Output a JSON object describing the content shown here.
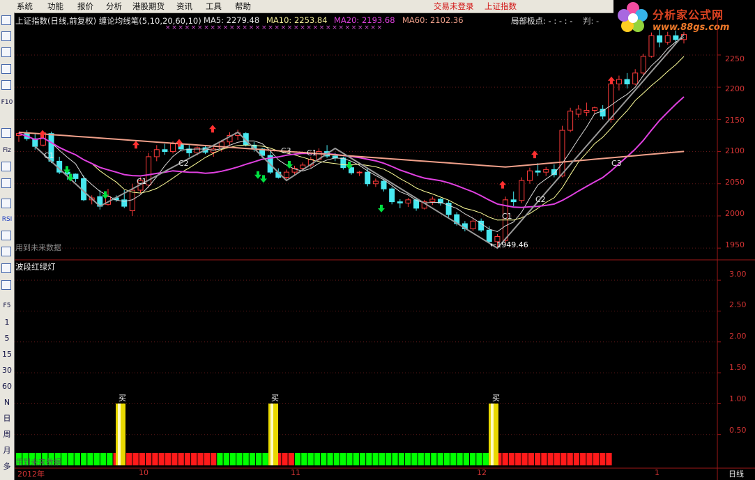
{
  "menu": {
    "items": [
      "系统",
      "功能",
      "报价",
      "分析",
      "港股期货",
      "资讯",
      "工具",
      "帮助"
    ],
    "login_status": "交易未登录",
    "index_name": "上证指数"
  },
  "logo": {
    "title": "分析家公式网",
    "url": "www.88gs.com"
  },
  "toolbar": {
    "labels": [
      "F10",
      "Fiz",
      "RSI",
      "F5",
      "1",
      "5",
      "15",
      "30",
      "60",
      "N",
      "日",
      "周",
      "月",
      "多"
    ]
  },
  "header": {
    "title": "上证指数(日线,前复权) 缠论均线笔(5,10,20,60,10)",
    "ma5": "MA5: 2279.48",
    "ma10": "MA10: 2253.84",
    "ma20": "MA20: 2193.68",
    "ma60": "MA60: 2102.36",
    "local_extreme": "局部极点: - : - : -",
    "judge": "判: -"
  },
  "main_panel": {
    "y_ticks": [
      "2250",
      "2200",
      "2150",
      "2100",
      "2050",
      "2000",
      "1950"
    ],
    "low_label": "←1949.46",
    "future_note": "用到未来数据",
    "pen_labels": [
      "C1",
      "C2",
      "C3",
      "C1",
      "C1",
      "C2",
      "C3"
    ]
  },
  "indicator_panel": {
    "title": "波段红绿灯",
    "y_ticks": [
      "3.00",
      "2.50",
      "2.00",
      "1.50",
      "1.00",
      "0.50"
    ],
    "buy_label": "买",
    "future_note": "用到未来数据"
  },
  "x_axis": {
    "labels": [
      "2012年",
      "10",
      "11",
      "12",
      "1"
    ],
    "period": "日线"
  },
  "colors": {
    "up": "#ff3b3b",
    "down": "#48e8f0",
    "ma5": "#d9d9d9",
    "ma10": "#ffff9a",
    "ma20": "#e040e0",
    "ma60": "#f0a08a",
    "pen": "#9a9a9a",
    "green_bar": "#00ff00",
    "red_bar": "#ff1a1a",
    "yellow_bar": "#e8d800"
  },
  "chart_data": {
    "type": "candlestick",
    "y_range": [
      1935,
      2290
    ],
    "candles": [
      {
        "o": 2125,
        "h": 2130,
        "l": 2115,
        "c": 2128
      },
      {
        "o": 2128,
        "h": 2133,
        "l": 2117,
        "c": 2120
      },
      {
        "o": 2120,
        "h": 2127,
        "l": 2103,
        "c": 2108
      },
      {
        "o": 2110,
        "h": 2132,
        "l": 2108,
        "c": 2129
      },
      {
        "o": 2128,
        "h": 2131,
        "l": 2082,
        "c": 2085
      },
      {
        "o": 2085,
        "h": 2092,
        "l": 2065,
        "c": 2068
      },
      {
        "o": 2068,
        "h": 2072,
        "l": 2056,
        "c": 2065
      },
      {
        "o": 2065,
        "h": 2066,
        "l": 2053,
        "c": 2058
      },
      {
        "o": 2058,
        "h": 2063,
        "l": 2023,
        "c": 2025
      },
      {
        "o": 2025,
        "h": 2032,
        "l": 2018,
        "c": 2028
      },
      {
        "o": 2030,
        "h": 2040,
        "l": 2010,
        "c": 2015
      },
      {
        "o": 2018,
        "h": 2042,
        "l": 2016,
        "c": 2030
      },
      {
        "o": 2028,
        "h": 2032,
        "l": 2022,
        "c": 2025
      },
      {
        "o": 2025,
        "h": 2040,
        "l": 2012,
        "c": 2015
      },
      {
        "o": 2008,
        "h": 2050,
        "l": 2000,
        "c": 2040
      },
      {
        "o": 2040,
        "h": 2060,
        "l": 2035,
        "c": 2055
      },
      {
        "o": 2048,
        "h": 2098,
        "l": 2044,
        "c": 2092
      },
      {
        "o": 2092,
        "h": 2110,
        "l": 2085,
        "c": 2103
      },
      {
        "o": 2103,
        "h": 2112,
        "l": 2095,
        "c": 2100
      },
      {
        "o": 2100,
        "h": 2116,
        "l": 2097,
        "c": 2112
      },
      {
        "o": 2112,
        "h": 2115,
        "l": 2100,
        "c": 2104
      },
      {
        "o": 2104,
        "h": 2110,
        "l": 2092,
        "c": 2098
      },
      {
        "o": 2098,
        "h": 2108,
        "l": 2094,
        "c": 2106
      },
      {
        "o": 2106,
        "h": 2110,
        "l": 2096,
        "c": 2099
      },
      {
        "o": 2099,
        "h": 2108,
        "l": 2092,
        "c": 2104
      },
      {
        "o": 2104,
        "h": 2118,
        "l": 2100,
        "c": 2115
      },
      {
        "o": 2115,
        "h": 2130,
        "l": 2110,
        "c": 2125
      },
      {
        "o": 2125,
        "h": 2134,
        "l": 2118,
        "c": 2129
      },
      {
        "o": 2128,
        "h": 2130,
        "l": 2108,
        "c": 2110
      },
      {
        "o": 2110,
        "h": 2115,
        "l": 2100,
        "c": 2104
      },
      {
        "o": 2104,
        "h": 2106,
        "l": 2090,
        "c": 2094
      },
      {
        "o": 2094,
        "h": 2100,
        "l": 2065,
        "c": 2068
      },
      {
        "o": 2068,
        "h": 2074,
        "l": 2058,
        "c": 2060
      },
      {
        "o": 2060,
        "h": 2072,
        "l": 2057,
        "c": 2068
      },
      {
        "o": 2068,
        "h": 2078,
        "l": 2064,
        "c": 2074
      },
      {
        "o": 2074,
        "h": 2083,
        "l": 2070,
        "c": 2079
      },
      {
        "o": 2079,
        "h": 2092,
        "l": 2075,
        "c": 2088
      },
      {
        "o": 2088,
        "h": 2105,
        "l": 2085,
        "c": 2100
      },
      {
        "o": 2100,
        "h": 2110,
        "l": 2090,
        "c": 2093
      },
      {
        "o": 2093,
        "h": 2098,
        "l": 2085,
        "c": 2090
      },
      {
        "o": 2090,
        "h": 2092,
        "l": 2072,
        "c": 2075
      },
      {
        "o": 2075,
        "h": 2078,
        "l": 2064,
        "c": 2067
      },
      {
        "o": 2067,
        "h": 2070,
        "l": 2062,
        "c": 2068
      },
      {
        "o": 2068,
        "h": 2074,
        "l": 2046,
        "c": 2050
      },
      {
        "o": 2050,
        "h": 2058,
        "l": 2045,
        "c": 2054
      },
      {
        "o": 2054,
        "h": 2057,
        "l": 2038,
        "c": 2042
      },
      {
        "o": 2042,
        "h": 2045,
        "l": 2018,
        "c": 2022
      },
      {
        "o": 2022,
        "h": 2026,
        "l": 2012,
        "c": 2020
      },
      {
        "o": 2020,
        "h": 2028,
        "l": 2014,
        "c": 2025
      },
      {
        "o": 2025,
        "h": 2027,
        "l": 2008,
        "c": 2012
      },
      {
        "o": 2012,
        "h": 2025,
        "l": 2010,
        "c": 2022
      },
      {
        "o": 2022,
        "h": 2030,
        "l": 2017,
        "c": 2026
      },
      {
        "o": 2026,
        "h": 2028,
        "l": 2016,
        "c": 2020
      },
      {
        "o": 2020,
        "h": 2024,
        "l": 1998,
        "c": 2002
      },
      {
        "o": 2002,
        "h": 2006,
        "l": 1985,
        "c": 1988
      },
      {
        "o": 1988,
        "h": 1992,
        "l": 1976,
        "c": 1980
      },
      {
        "o": 1980,
        "h": 1995,
        "l": 1977,
        "c": 1992
      },
      {
        "o": 1992,
        "h": 1996,
        "l": 1975,
        "c": 1978
      },
      {
        "o": 1978,
        "h": 1984,
        "l": 1958,
        "c": 1960
      },
      {
        "o": 1960,
        "h": 1972,
        "l": 1950,
        "c": 1968
      },
      {
        "o": 1962,
        "h": 2030,
        "l": 1958,
        "c": 2025
      },
      {
        "o": 2025,
        "h": 2038,
        "l": 2015,
        "c": 2022
      },
      {
        "o": 2024,
        "h": 2060,
        "l": 2020,
        "c": 2055
      },
      {
        "o": 2055,
        "h": 2075,
        "l": 2050,
        "c": 2070
      },
      {
        "o": 2070,
        "h": 2082,
        "l": 2062,
        "c": 2068
      },
      {
        "o": 2068,
        "h": 2076,
        "l": 2062,
        "c": 2072
      },
      {
        "o": 2072,
        "h": 2080,
        "l": 2060,
        "c": 2064
      },
      {
        "o": 2062,
        "h": 2140,
        "l": 2060,
        "c": 2133
      },
      {
        "o": 2133,
        "h": 2168,
        "l": 2130,
        "c": 2163
      },
      {
        "o": 2158,
        "h": 2172,
        "l": 2153,
        "c": 2166
      },
      {
        "o": 2161,
        "h": 2176,
        "l": 2155,
        "c": 2164
      },
      {
        "o": 2164,
        "h": 2170,
        "l": 2158,
        "c": 2168
      },
      {
        "o": 2166,
        "h": 2172,
        "l": 2150,
        "c": 2155
      },
      {
        "o": 2150,
        "h": 2210,
        "l": 2145,
        "c": 2205
      },
      {
        "o": 2205,
        "h": 2218,
        "l": 2195,
        "c": 2212
      },
      {
        "o": 2212,
        "h": 2222,
        "l": 2198,
        "c": 2205
      },
      {
        "o": 2205,
        "h": 2228,
        "l": 2203,
        "c": 2222
      },
      {
        "o": 2222,
        "h": 2252,
        "l": 2218,
        "c": 2248
      },
      {
        "o": 2248,
        "h": 2285,
        "l": 2246,
        "c": 2280
      },
      {
        "o": 2280,
        "h": 2290,
        "l": 2262,
        "c": 2270
      },
      {
        "o": 2270,
        "h": 2286,
        "l": 2266,
        "c": 2280
      },
      {
        "o": 2280,
        "h": 2288,
        "l": 2268,
        "c": 2274
      },
      {
        "o": 2274,
        "h": 2286,
        "l": 2268,
        "c": 2282
      }
    ],
    "signals_per_bar": [
      0,
      0,
      0,
      0,
      0,
      0,
      0,
      0,
      0,
      0,
      0,
      0,
      0,
      0,
      1,
      1,
      1,
      1,
      1,
      1,
      1,
      1,
      1,
      1,
      1,
      1,
      1,
      1,
      1,
      1,
      1,
      1,
      1,
      1,
      1,
      1,
      1,
      1,
      1,
      1,
      1,
      1,
      1,
      1,
      1,
      1,
      1,
      1,
      1,
      1,
      1,
      1,
      1,
      1,
      1,
      1,
      1,
      1,
      1,
      1,
      1,
      1,
      1,
      1,
      1,
      1,
      1,
      1,
      1,
      1,
      1,
      1,
      1,
      1,
      1,
      1,
      1,
      1,
      1,
      1,
      1,
      1,
      1
    ],
    "buy_signals": [
      12,
      30,
      57
    ],
    "lows_marked": [
      {
        "label": "1949.46"
      }
    ]
  }
}
